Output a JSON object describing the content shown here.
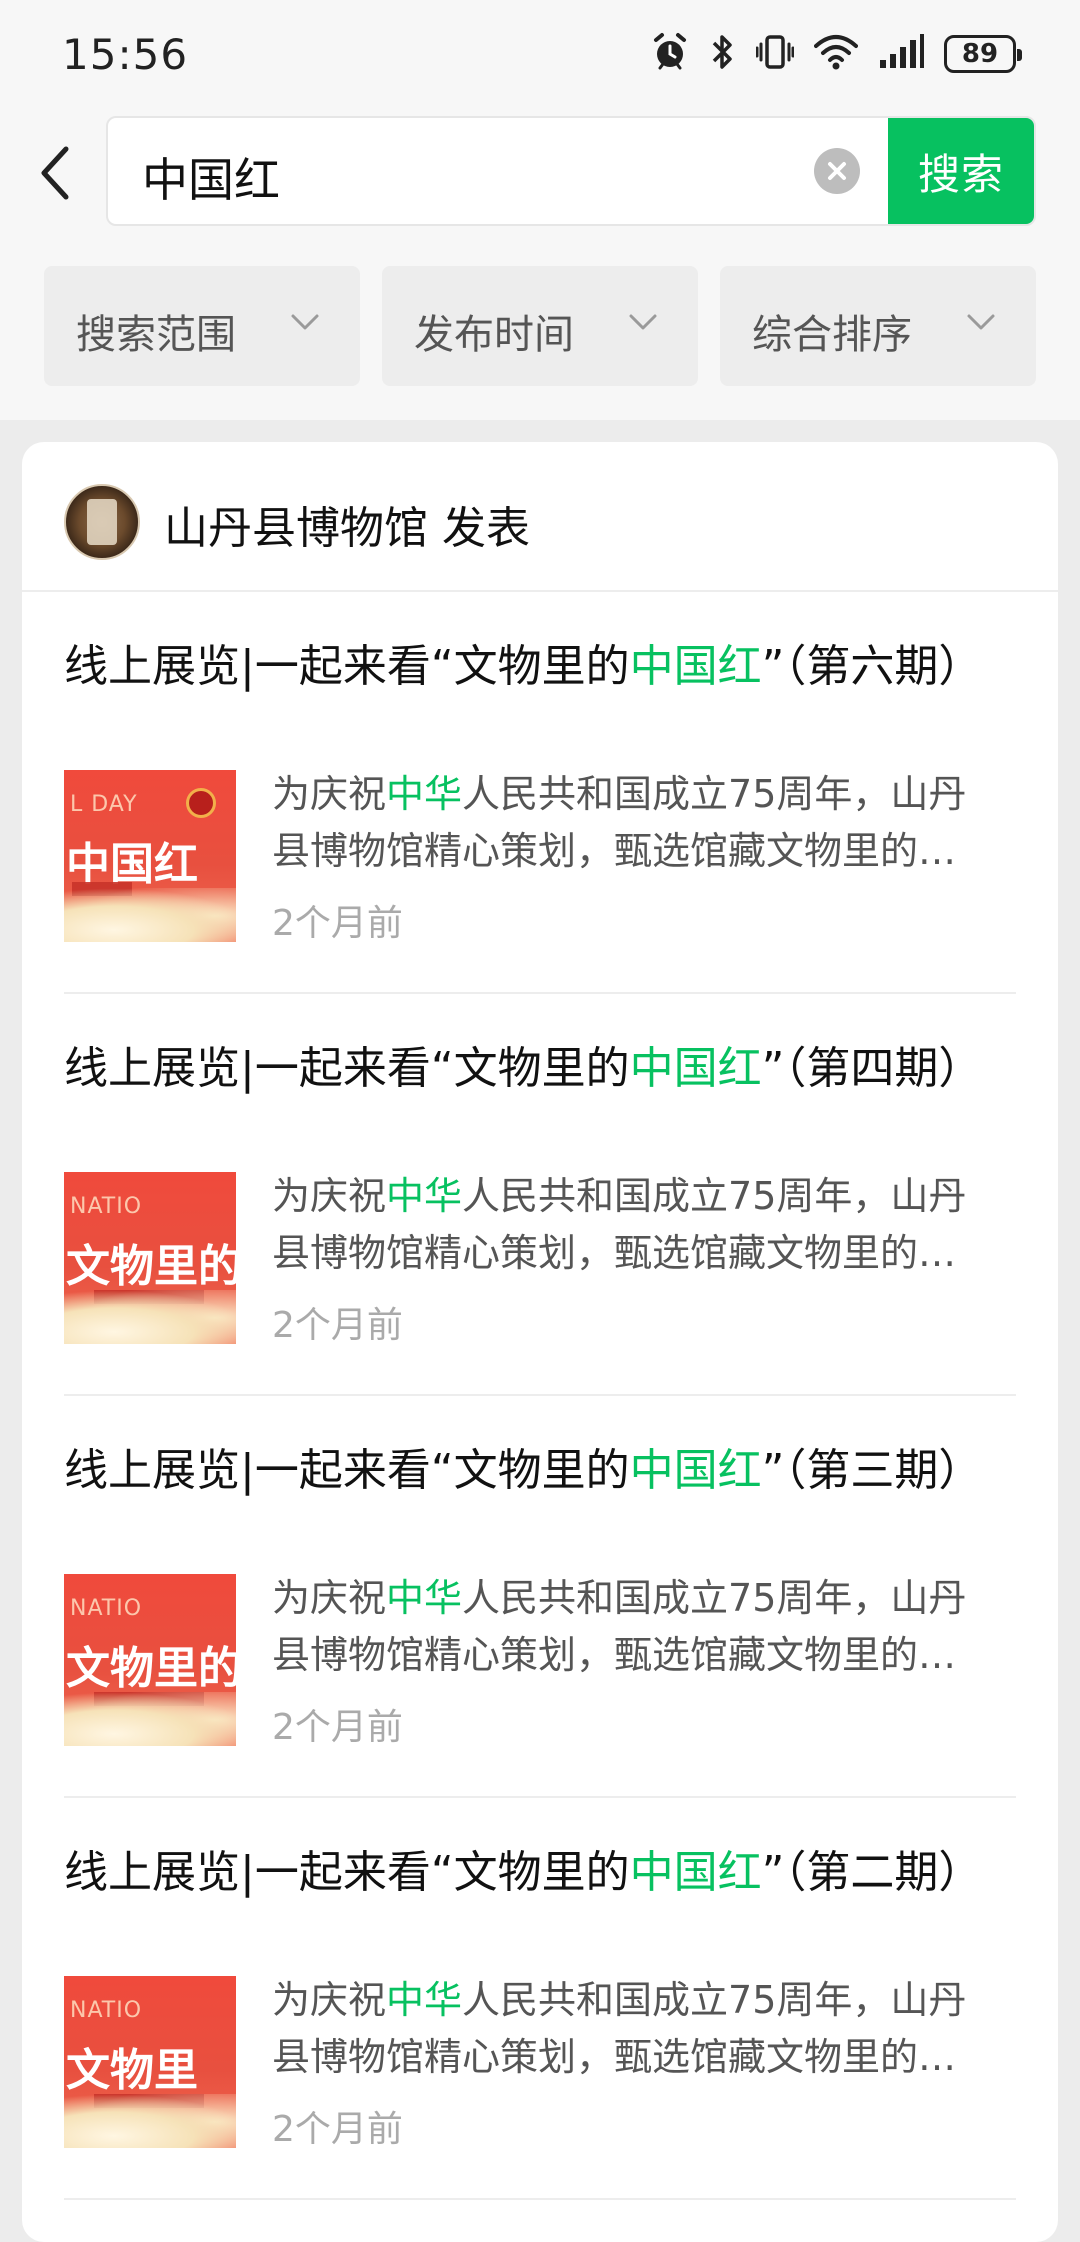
{
  "status_bar": {
    "time": "15:56",
    "battery": "89"
  },
  "search": {
    "query": "中国红",
    "button_label": "搜索"
  },
  "filters": [
    {
      "label": "搜索范围"
    },
    {
      "label": "发布时间"
    },
    {
      "label": "综合排序"
    }
  ],
  "publisher": {
    "name": "山丹县博物馆 发表"
  },
  "results": [
    {
      "title_pre": "线上展览|一起来看“文物里的",
      "title_hl": "中国红",
      "title_post": "”（第六期）",
      "desc_line1_pre": "为庆祝",
      "desc_line1_hl": "中华",
      "desc_line1_post": "人民共和国成立75周年，山丹",
      "desc_line2": "县博物馆精心策划，甄选馆藏文物里的…",
      "time": "2个月前",
      "thumb_small": "L DAY",
      "thumb_text": "中国红"
    },
    {
      "title_pre": "线上展览|一起来看“文物里的",
      "title_hl": "中国红",
      "title_post": "”（第四期）",
      "desc_line1_pre": "为庆祝",
      "desc_line1_hl": "中华",
      "desc_line1_post": "人民共和国成立75周年，山丹",
      "desc_line2": "县博物馆精心策划，甄选馆藏文物里的…",
      "time": "2个月前",
      "thumb_small": "NATIO",
      "thumb_text": "文物里的"
    },
    {
      "title_pre": "线上展览|一起来看“文物里的",
      "title_hl": "中国红",
      "title_post": "”（第三期）",
      "desc_line1_pre": "为庆祝",
      "desc_line1_hl": "中华",
      "desc_line1_post": "人民共和国成立75周年，山丹",
      "desc_line2": "县博物馆精心策划，甄选馆藏文物里的…",
      "time": "2个月前",
      "thumb_small": "NATIO",
      "thumb_text": "文物里的"
    },
    {
      "title_pre": "线上展览|一起来看“文物里的",
      "title_hl": "中国红",
      "title_post": "”（第二期）",
      "desc_line1_pre": "为庆祝",
      "desc_line1_hl": "中华",
      "desc_line1_post": "人民共和国成立75周年，山丹",
      "desc_line2": "县博物馆精心策划，甄选馆藏文物里的…",
      "time": "2个月前",
      "thumb_small": "NATIO",
      "thumb_text": "文物里"
    }
  ],
  "colors": {
    "accent": "#07c160",
    "background": "#ececec",
    "thumb_red": "#f04a3c"
  },
  "icons": [
    "alarm-icon",
    "bluetooth-icon",
    "vibrate-icon",
    "wifi-icon",
    "signal-icon",
    "battery-icon",
    "back-arrow-icon",
    "clear-icon",
    "chevron-down-icon"
  ]
}
